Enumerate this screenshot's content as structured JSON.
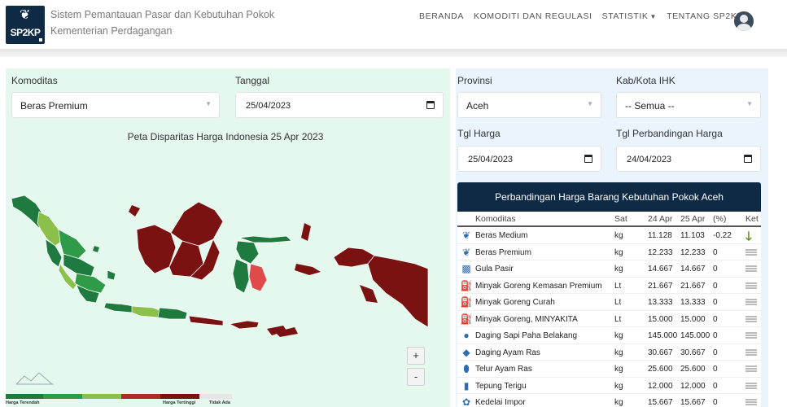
{
  "header": {
    "logo_text": "SP2KP",
    "title_line1": "Sistem Pemantauan Pasar dan Kebutuhan Pokok",
    "title_line2": "Kementerian Perdagangan",
    "nav": [
      "BERANDA",
      "KOMODITI DAN REGULASI",
      "STATISTIK",
      "TENTANG SP2KP"
    ]
  },
  "filters_left": {
    "komoditas_label": "Komoditas",
    "komoditas_value": "Beras Premium",
    "tanggal_label": "Tanggal",
    "tanggal_value": "25/04/2023"
  },
  "map": {
    "title": "Peta Disparitas Harga Indonesia 25 Apr 2023",
    "zoom_in": "+",
    "zoom_out": "-",
    "legend_low": "Harga Terendah",
    "legend_high": "Harga Tertinggi",
    "legend_none": "Tidak Ada",
    "colors": {
      "dark_green": "#1e7a3e",
      "mid_green": "#2f9b48",
      "light_green": "#8bc04a",
      "dark_red": "#7a1212",
      "red": "#b02a2a",
      "light_red": "#e04a4a"
    }
  },
  "filters_right": {
    "provinsi_label": "Provinsi",
    "provinsi_value": "Aceh",
    "kab_label": "Kab/Kota IHK",
    "kab_value": "-- Semua --",
    "tgl_harga_label": "Tgl Harga",
    "tgl_harga_value": "25/04/2023",
    "tgl_banding_label": "Tgl Perbandingan Harga",
    "tgl_banding_value": "24/04/2023"
  },
  "comparison": {
    "title": "Perbandingan Harga Barang Kebutuhan Pokok Aceh",
    "headers": {
      "komoditas": "Komoditas",
      "sat": "Sat",
      "d24": "24 Apr",
      "d25": "25 Apr",
      "pct": "(%)",
      "ket": "Ket"
    },
    "rows": [
      {
        "icon": "rice-icon",
        "glyph": "❦",
        "komoditas": "Beras Medium",
        "sat": "kg",
        "d24": "11.128",
        "d25": "11.103",
        "pct": "-0.22",
        "ket": "down"
      },
      {
        "icon": "rice-icon",
        "glyph": "❦",
        "komoditas": "Beras Premium",
        "sat": "kg",
        "d24": "12.233",
        "d25": "12.233",
        "pct": "0",
        "ket": "equal"
      },
      {
        "icon": "sugar-icon",
        "glyph": "▩",
        "komoditas": "Gula Pasir",
        "sat": "kg",
        "d24": "14.667",
        "d25": "14.667",
        "pct": "0",
        "ket": "equal"
      },
      {
        "icon": "oil-icon",
        "glyph": "⛽",
        "komoditas": "Minyak Goreng Kemasan Premium",
        "sat": "Lt",
        "d24": "21.667",
        "d25": "21.667",
        "pct": "0",
        "ket": "equal"
      },
      {
        "icon": "oil-icon",
        "glyph": "⛽",
        "komoditas": "Minyak Goreng Curah",
        "sat": "Lt",
        "d24": "13.333",
        "d25": "13.333",
        "pct": "0",
        "ket": "equal"
      },
      {
        "icon": "oil-icon",
        "glyph": "⛽",
        "komoditas": "Minyak Goreng, MINYAKITA",
        "sat": "Lt",
        "d24": "15.000",
        "d25": "15.000",
        "pct": "0",
        "ket": "equal"
      },
      {
        "icon": "beef-icon",
        "glyph": "●",
        "komoditas": "Daging Sapi Paha Belakang",
        "sat": "kg",
        "d24": "145.000",
        "d25": "145.000",
        "pct": "0",
        "ket": "equal"
      },
      {
        "icon": "chicken-icon",
        "glyph": "◆",
        "komoditas": "Daging Ayam Ras",
        "sat": "kg",
        "d24": "30.667",
        "d25": "30.667",
        "pct": "0",
        "ket": "equal"
      },
      {
        "icon": "egg-icon",
        "glyph": "⬮",
        "komoditas": "Telur Ayam Ras",
        "sat": "kg",
        "d24": "25.600",
        "d25": "25.600",
        "pct": "0",
        "ket": "equal"
      },
      {
        "icon": "flour-icon",
        "glyph": "▮",
        "komoditas": "Tepung Terigu",
        "sat": "kg",
        "d24": "12.000",
        "d25": "12.000",
        "pct": "0",
        "ket": "equal"
      },
      {
        "icon": "soybean-icon",
        "glyph": "✿",
        "komoditas": "Kedelai Impor",
        "sat": "kg",
        "d24": "15.667",
        "d25": "15.667",
        "pct": "0",
        "ket": "equal"
      }
    ]
  }
}
